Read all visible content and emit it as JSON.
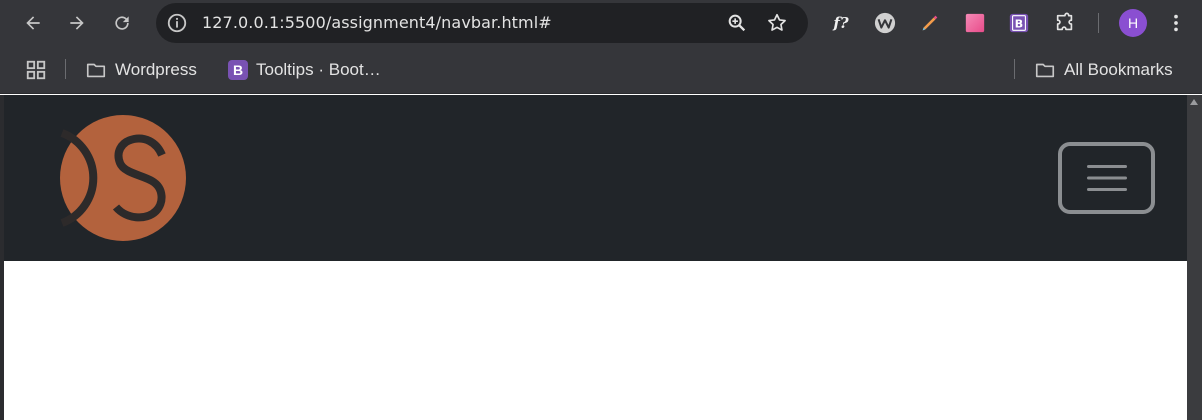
{
  "browser": {
    "address_bar": {
      "url": "127.0.0.1:5500/assignment4/navbar.html#"
    },
    "profile_initial": "H",
    "bookmarks": [
      {
        "label": "Wordpress",
        "icon": "folder-icon"
      },
      {
        "label": "Tooltips · Boot…",
        "icon": "bootstrap-icon"
      }
    ],
    "all_bookmarks_label": "All Bookmarks",
    "bootstrap_favicon_letter": "B",
    "ext_fonts_label": "f?"
  },
  "page": {
    "navbar_bg": "#212529",
    "logo": {
      "text": "DS",
      "color": "#b3623d"
    },
    "toggler": {
      "border_color": "#8b8e91"
    }
  }
}
